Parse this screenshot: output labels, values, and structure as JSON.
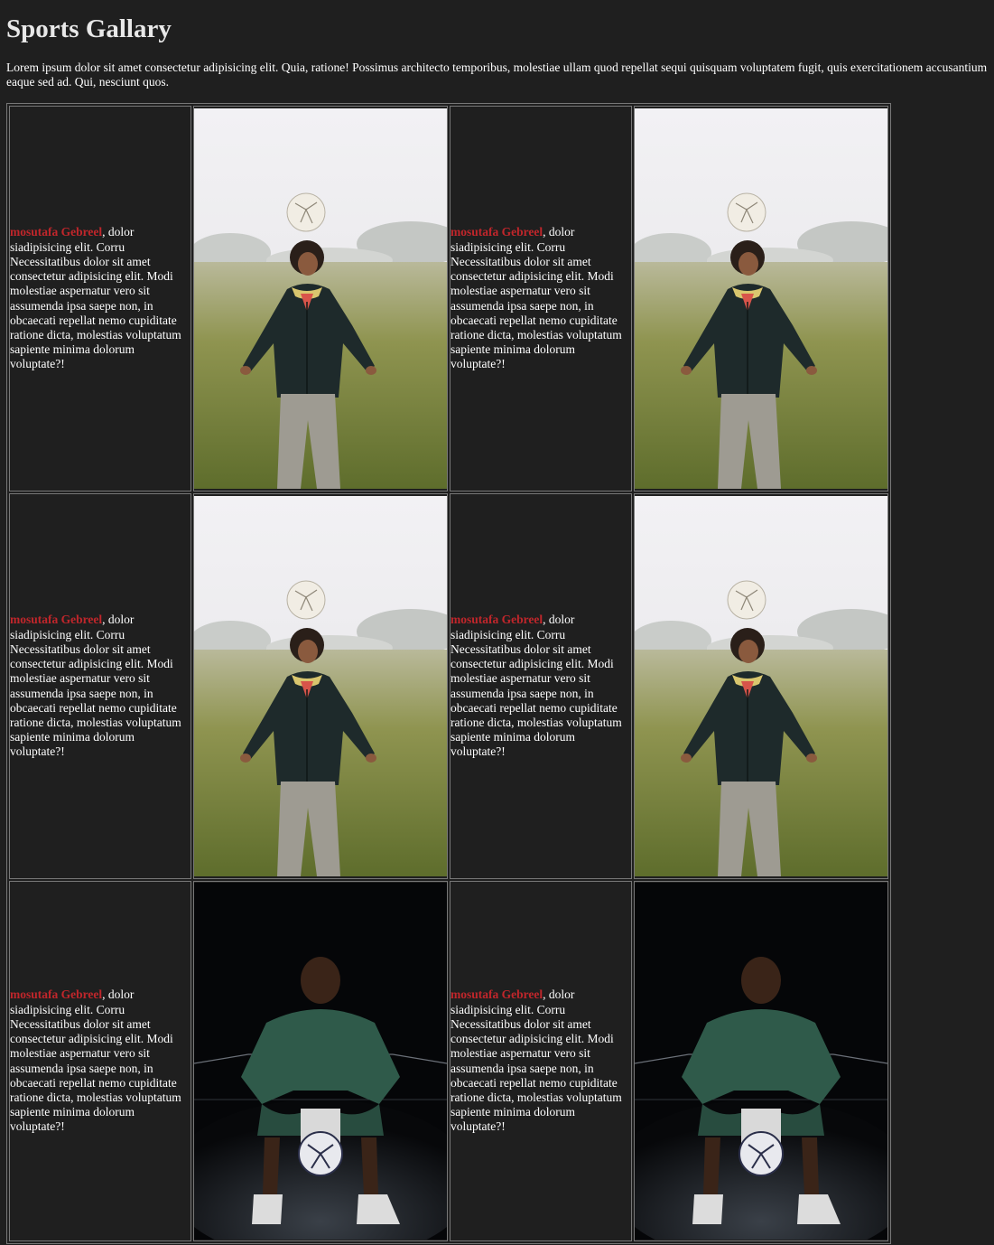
{
  "page": {
    "title": "Sports Gallary",
    "intro": "Lorem ipsum dolor sit amet consectetur adipisicing elit. Quia, ratione! Possimus architecto temporibus, molestiae ullam quod repellat sequi quisquam voluptatem fugit, quis exercitationem accusantium eaque sed ad. Qui, nesciunt quos."
  },
  "caption": {
    "name": "mosutafa Gebreel",
    "text": ", dolor siadipisicing elit. Corru Necessitatibus dolor sit amet consectetur adipisicing elit. Modi molestiae aspernatur vero sit assumenda ipsa saepe non, in obcaecati repellat nemo cupiditate ratione dicta, molestias voluptatum sapiente minima dolorum voluptate?!"
  },
  "photos": {
    "header_ball": "footballer-heading-ball-photo",
    "crouching": "footballer-crouching-on-ball-photo"
  },
  "colors": {
    "background": "#1f1f1f",
    "name_accent": "#c0262b",
    "border": "#777777"
  }
}
